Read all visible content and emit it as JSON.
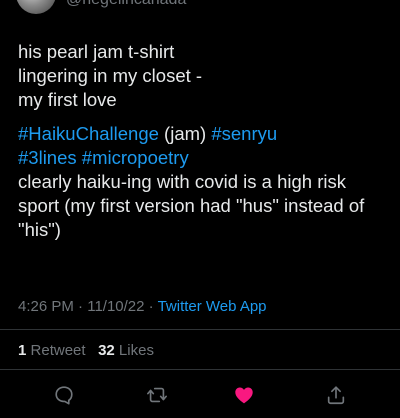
{
  "author": {
    "handle": "@negelincanada"
  },
  "tweet": {
    "text_lines": [
      "his pearl jam t-shirt",
      "lingering in my closet -",
      "my first love"
    ],
    "hashtags": {
      "haiku_challenge": "#HaikuChallenge",
      "jam": " (jam) ",
      "senryu": "#senryu",
      "three_lines": "#3lines",
      "micropoetry": "#micropoetry"
    },
    "comment": "clearly haiku-ing with covid is a high risk sport (my first version had \"hus\" instead of \"his\")"
  },
  "meta": {
    "time": "4:26 PM",
    "date": "11/10/22",
    "separator": " · ",
    "source": "Twitter Web App"
  },
  "stats": {
    "retweets_count": "1",
    "retweets_label": "Retweet",
    "likes_count": "32",
    "likes_label": "Likes"
  },
  "actions": {
    "reply_icon": "reply-icon",
    "retweet_icon": "retweet-icon",
    "like_icon": "heart-icon",
    "share_icon": "share-icon"
  },
  "colors": {
    "background": "#000000",
    "text": "#e7e9ea",
    "secondary": "#71767b",
    "link": "#1d9bf0",
    "like": "#f91880",
    "divider": "#2f3336"
  }
}
